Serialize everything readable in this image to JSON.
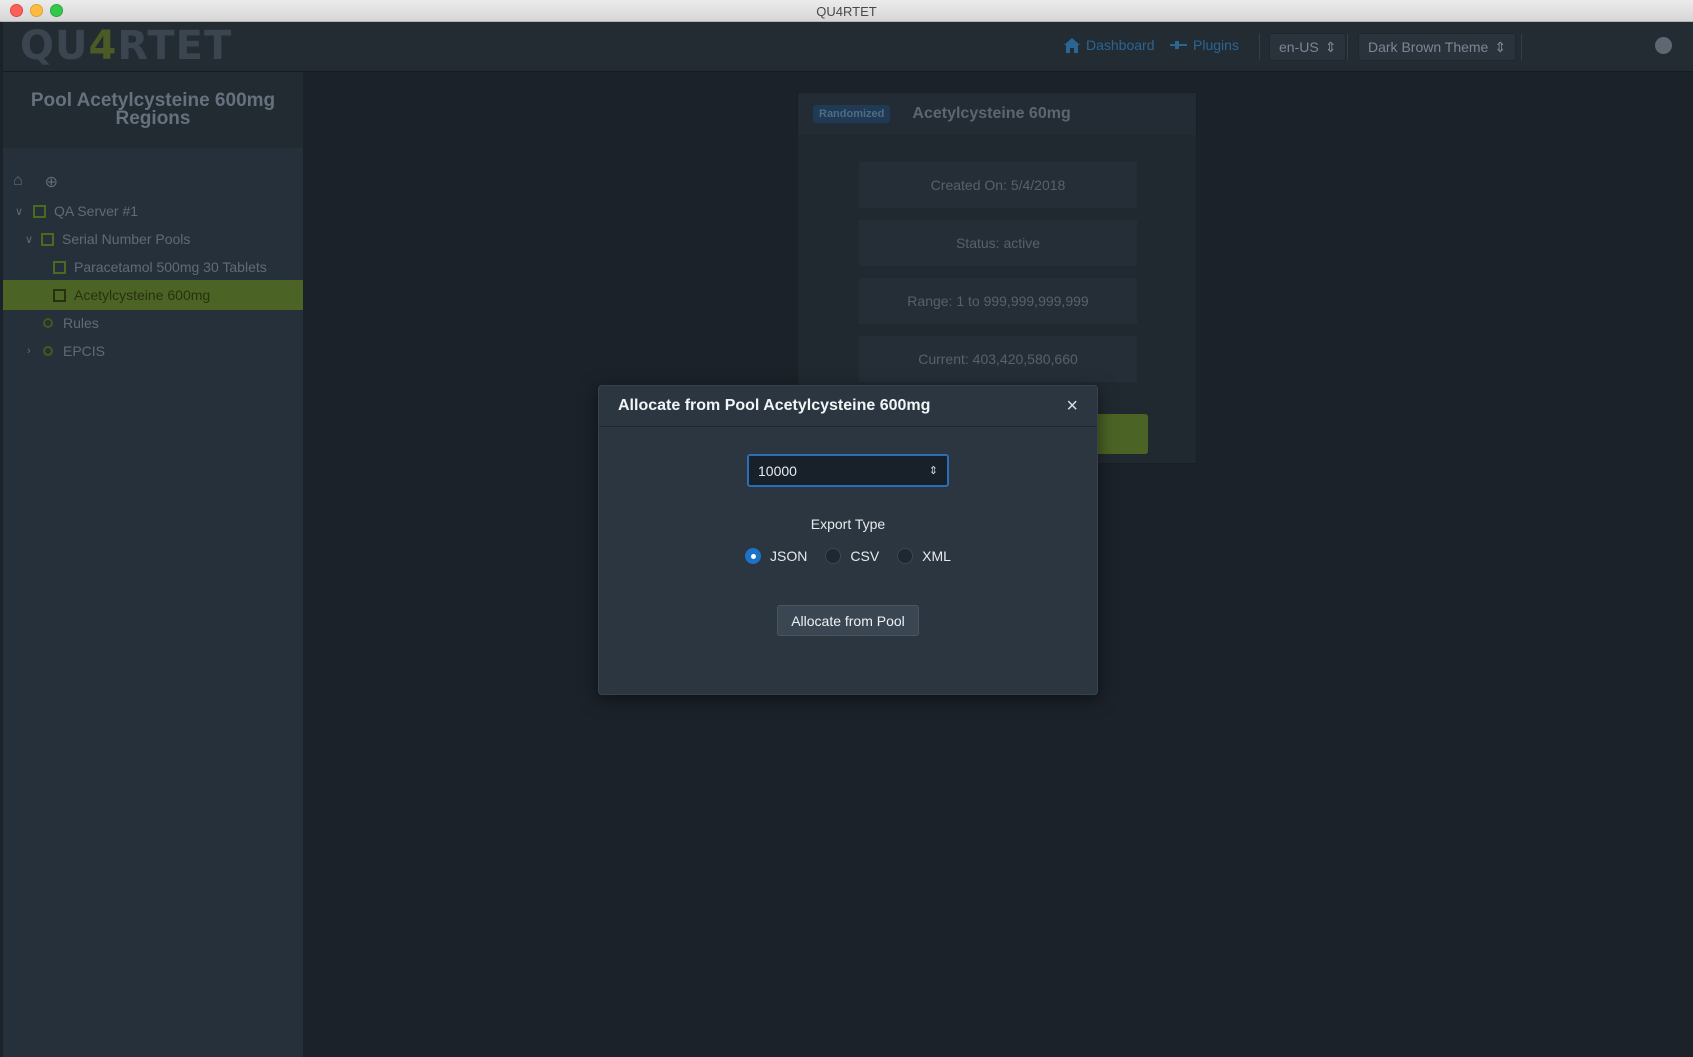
{
  "window": {
    "title": "QU4RTET"
  },
  "navbar": {
    "logo_left": "QU",
    "logo_four": "4",
    "logo_right": "RTET",
    "dashboard_label": "Dashboard",
    "plugins_label": "Plugins",
    "language": "en-US",
    "theme": "Dark Brown Theme"
  },
  "sidebar": {
    "header": "Pool Acetylcysteine 600mg Regions",
    "tree": {
      "server": "QA Server #1",
      "serial_pools": "Serial Number Pools",
      "pool_1": "Paracetamol 500mg 30 Tablets",
      "pool_2": "Acetylcysteine 600mg",
      "rules": "Rules",
      "epcis": "EPCIS"
    }
  },
  "card": {
    "badge": "Randomized",
    "title": "Acetylcysteine 60mg",
    "created": "Created On: 5/4/2018",
    "status": "Status: active",
    "range": "Range: 1 to 999,999,999,999",
    "current": "Current: 403,420,580,660"
  },
  "modal": {
    "title": "Allocate from Pool Acetylcysteine 600mg",
    "quantity": "10000",
    "export_label": "Export Type",
    "options": [
      "JSON",
      "CSV",
      "XML"
    ],
    "selected": "JSON",
    "submit_label": "Allocate from Pool"
  }
}
